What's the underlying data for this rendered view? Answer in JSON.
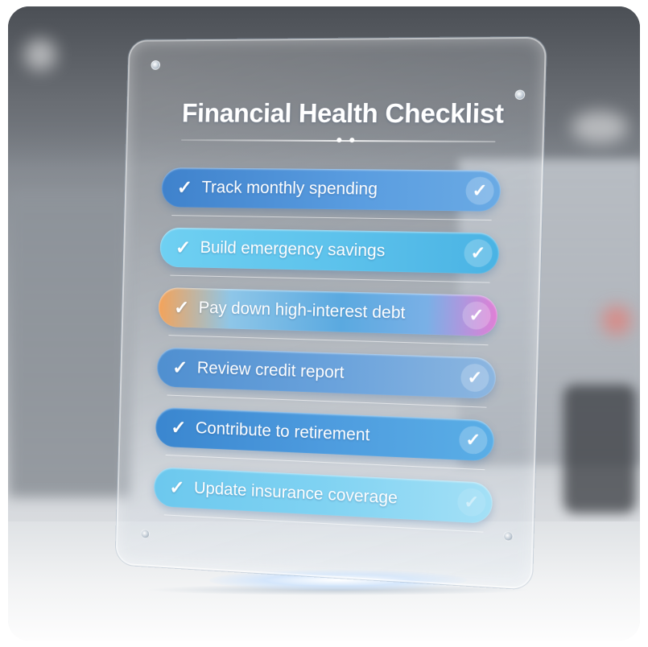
{
  "panel": {
    "title": "Financial Health Checklist",
    "check_glyph": "✓",
    "items": [
      {
        "label": "Track monthly spending"
      },
      {
        "label": "Build emergency savings"
      },
      {
        "label": "Pay down high-interest debt"
      },
      {
        "label": "Review credit report"
      },
      {
        "label": "Contribute to retirement"
      },
      {
        "label": "Update insurance coverage"
      }
    ]
  },
  "colors": {
    "item_blue": "#4a90d9",
    "item_cyan": "#5bc5ec",
    "item_gradient_warm": "#f4a35a",
    "item_gradient_pink": "#e07fd6",
    "glass_edge": "#ffffff",
    "background_gray": "#8a8f96"
  }
}
